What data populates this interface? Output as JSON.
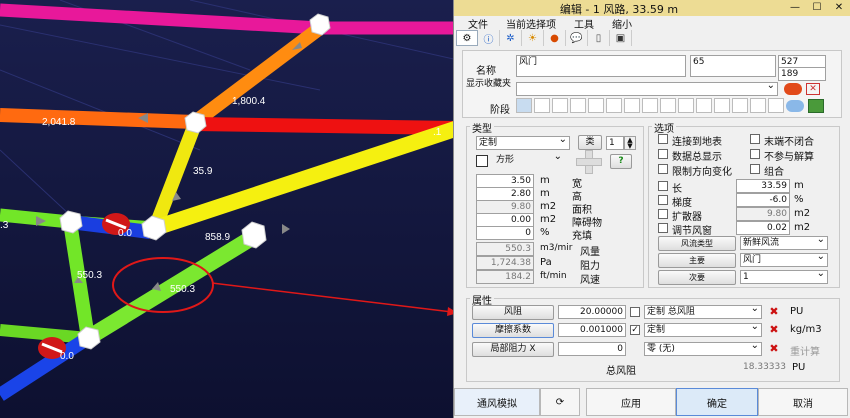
{
  "scene": {
    "labels": [
      "1,800.4",
      "2,041.8",
      "35.9",
      "550.3",
      "550.3",
      "0.0",
      "0.0",
      "0.0",
      ".3",
      ".1",
      "858.9"
    ]
  },
  "dialog": {
    "title": "编辑 - 1 风路, 33.59 m",
    "menu": [
      "文件",
      "当前选择项",
      "工具",
      "缩小"
    ],
    "name_label": "名称",
    "name_value": "风门",
    "id_value": "65",
    "node_from": "527",
    "node_to": "189",
    "favorites_label": "显示收藏夹",
    "stage_label": "阶段",
    "type_title": "类型",
    "type_value": "定制",
    "class_label": "类",
    "class_value": "1",
    "shape_value": "方形",
    "help_label": "?",
    "width_value": "3.50",
    "width_unit": "m",
    "width_label": "宽",
    "height_value": "2.80",
    "height_unit": "m",
    "height_label": "高",
    "area_value": "9.80",
    "area_unit": "m2",
    "area_label": "面积",
    "obstacle_value": "0.00",
    "obstacle_unit": "m2",
    "obstacle_label": "障碍物",
    "fill_value": "0",
    "fill_unit": "%",
    "fill_label": "充填",
    "flow_value": "550.3",
    "flow_unit": "m3/mir",
    "flow_label": "风量",
    "resist_value": "1,724.38",
    "resist_unit": "Pa",
    "resist_label": "阻力",
    "speed_value": "184.2",
    "speed_unit": "ft/min",
    "speed_label": "风速",
    "options_title": "选项",
    "options": [
      "连接到地表",
      "末端不闭合",
      "数据总显示",
      "不参与解算",
      "限制方向变化",
      "组合"
    ],
    "length_label": "长",
    "length_value": "33.59",
    "length_unit": "m",
    "grade_label": "梯度",
    "grade_value": "-6.0",
    "grade_unit": "%",
    "diffuser_label": "扩散器",
    "diffuser_value": "9.80",
    "diffuser_unit": "m2",
    "regulator_label": "调节风窗",
    "regulator_value": "0.02",
    "regulator_unit": "m2",
    "airtype_button": "风流类型",
    "airtype_value": "新鲜风流",
    "main_button": "主要",
    "main_value": "风门",
    "second_button": "次要",
    "second_value": "1",
    "props_title": "属性",
    "resistance_button": "风阻",
    "resistance_value": "20.00000",
    "resistance_select": "定制 总风阻",
    "resistance_unit": "PU",
    "friction_button": "摩擦系数",
    "friction_value": "0.001000",
    "friction_select": "定制",
    "friction_unit": "kg/m3",
    "local_button": "局部阻力 X",
    "local_value": "0",
    "local_select": "零 (无)",
    "recalc_label": "重计算",
    "total_label": "总风阻",
    "total_value": "18.33333",
    "total_unit": "PU",
    "btn_sim": "通风模拟",
    "btn_apply": "应用",
    "btn_ok": "确定",
    "btn_cancel": "取消"
  },
  "colors": {
    "accent": "#eddc94",
    "delete": "#cc1111"
  }
}
